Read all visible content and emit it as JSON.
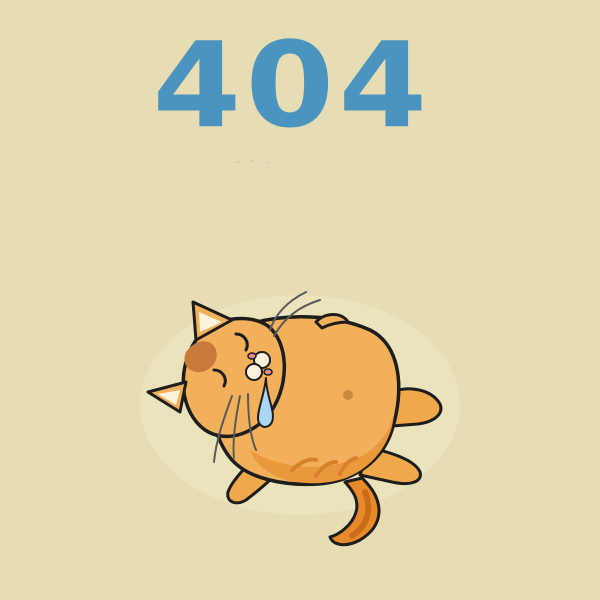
{
  "error_page": {
    "code": "404",
    "code_color": "#4a94bf",
    "background_color": "#e6ddb4",
    "illustration": "sad-cat-lying-on-back-drooling"
  }
}
